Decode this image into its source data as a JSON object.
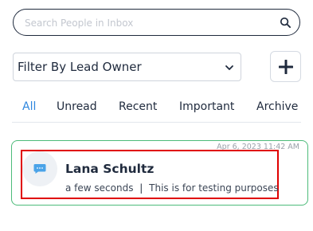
{
  "search": {
    "placeholder": "Search People in Inbox",
    "icon": "search-icon"
  },
  "filter": {
    "selected": "Filter By Lead Owner"
  },
  "add_button": {
    "icon": "plus-icon",
    "color": "#1f2a3d"
  },
  "tabs": [
    {
      "label": "All",
      "active": true
    },
    {
      "label": "Unread",
      "active": false
    },
    {
      "label": "Recent",
      "active": false
    },
    {
      "label": "Important",
      "active": false
    },
    {
      "label": "Archive",
      "active": false
    }
  ],
  "colors": {
    "accent": "#2e86de",
    "card_border": "#4dbb7a",
    "highlight": "#e00000"
  },
  "conversations": [
    {
      "date": "Apr 6, 2023 11:42 AM",
      "name": "Lana Schultz",
      "time": "a few seconds",
      "separator": "|",
      "preview": "This is for testing purposes",
      "icon": "chat-bubble-icon"
    }
  ]
}
